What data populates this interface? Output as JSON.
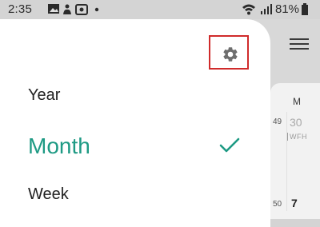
{
  "status_bar": {
    "time": "2:35",
    "battery": "81%",
    "icons": [
      "gallery-icon",
      "cat-icon",
      "photo-icon",
      "dot-icon",
      "wifi-icon",
      "signal-icon",
      "battery-icon"
    ]
  },
  "drawer": {
    "options": [
      {
        "label": "Year",
        "selected": false
      },
      {
        "label": "Month",
        "selected": true
      },
      {
        "label": "Week",
        "selected": false
      }
    ],
    "settings_icon": "gear-icon",
    "accent_color": "#1e9a84",
    "highlight_color": "#d02b2b"
  },
  "calendar": {
    "column_header": "M",
    "weeks": [
      {
        "number": "49",
        "date": "30",
        "event": "WFH"
      },
      {
        "number": "50",
        "date": "7"
      }
    ]
  }
}
